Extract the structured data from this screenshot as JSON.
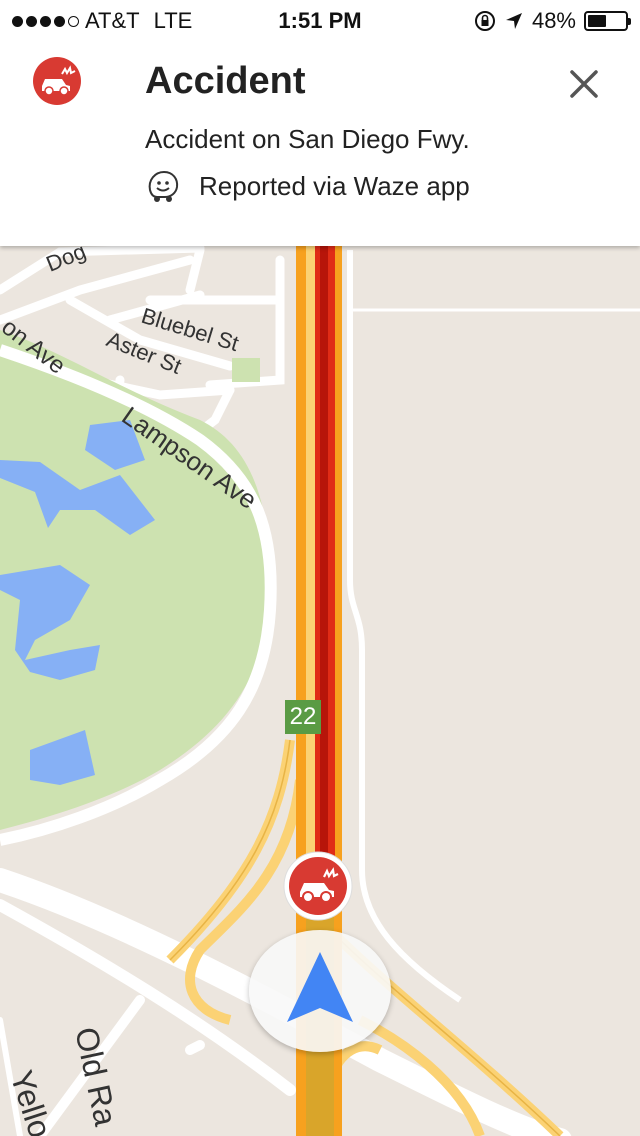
{
  "status_bar": {
    "carrier": "AT&T",
    "network": "LTE",
    "time": "1:51 PM",
    "battery_percent": "48%",
    "battery_level": 0.48,
    "signal_bars_filled": 4,
    "signal_bars_total": 5
  },
  "incident": {
    "title": "Accident",
    "description": "Accident on San Diego Fwy.",
    "source": "Reported via Waze app",
    "icon": "car-crash-icon",
    "accent_color": "#d83a32"
  },
  "map": {
    "streets": {
      "dog": "Dog",
      "on_ave": "on Ave",
      "bluebell": "Bluebel St",
      "aster": "Aster St",
      "lampson": "Lampson Ave",
      "old_ran": "Old Ra",
      "yellow": "Yello"
    },
    "route_shield": "22",
    "colors": {
      "background": "#ece6df",
      "park": "#cde2b0",
      "water": "#86b0f5",
      "freeway": "#f7a11e",
      "congestion": "#e02c16",
      "ramp": "#fbd274"
    }
  },
  "navigation": {
    "icon": "navigation-arrow-icon",
    "arrow_color": "#4285f4"
  }
}
